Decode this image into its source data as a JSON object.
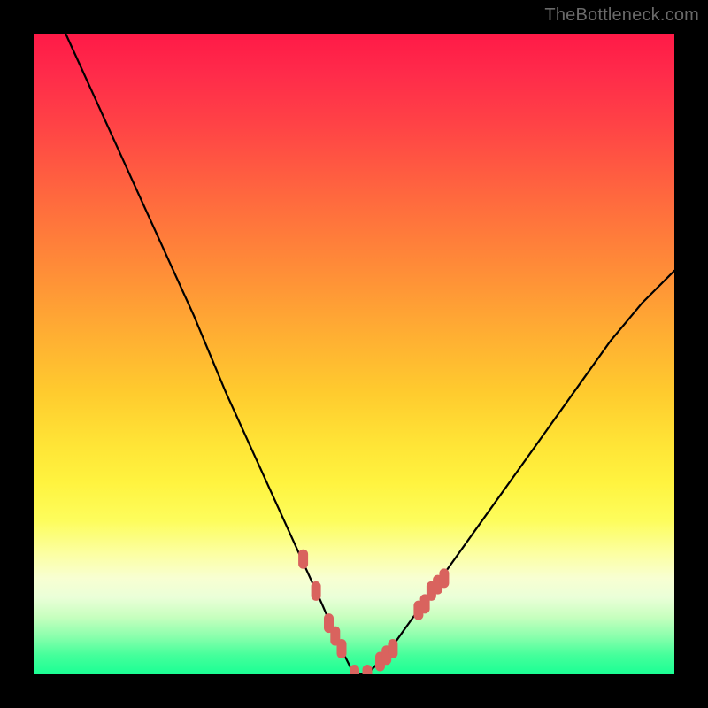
{
  "watermark": "TheBottleneck.com",
  "chart_data": {
    "type": "line",
    "title": "",
    "xlabel": "",
    "ylabel": "",
    "xlim": [
      0,
      100
    ],
    "ylim": [
      0,
      100
    ],
    "grid": false,
    "legend": false,
    "series": [
      {
        "name": "curve",
        "color": "#000000",
        "x": [
          5,
          10,
          15,
          20,
          25,
          30,
          35,
          40,
          45,
          48,
          50,
          52,
          55,
          60,
          65,
          70,
          75,
          80,
          85,
          90,
          95,
          100
        ],
        "y": [
          100,
          89,
          78,
          67,
          56,
          44,
          33,
          22,
          11,
          4,
          0,
          0,
          3,
          10,
          17,
          24,
          31,
          38,
          45,
          52,
          58,
          63
        ]
      },
      {
        "name": "highlight-dots",
        "color": "#d9635e",
        "x": [
          42,
          44,
          46,
          47,
          48,
          50,
          52,
          54,
          55,
          56,
          60,
          61,
          62,
          63,
          64
        ],
        "y": [
          18,
          13,
          8,
          6,
          4,
          0,
          0,
          2,
          3,
          4,
          10,
          11,
          13,
          14,
          15
        ]
      }
    ],
    "gradient_stops": [
      {
        "pos": 0.0,
        "color": "#ff1a47"
      },
      {
        "pos": 0.3,
        "color": "#ff8a38"
      },
      {
        "pos": 0.62,
        "color": "#ffe436"
      },
      {
        "pos": 0.8,
        "color": "#fcffa0"
      },
      {
        "pos": 1.0,
        "color": "#1aff94"
      }
    ]
  }
}
